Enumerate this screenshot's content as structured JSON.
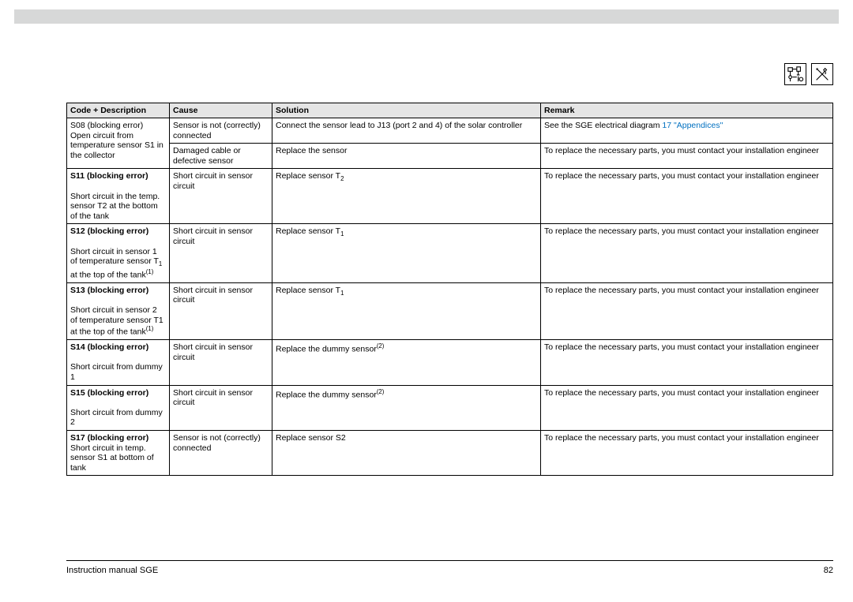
{
  "headers": {
    "code": "Code + Description",
    "cause": "Cause",
    "solution": "Solution",
    "remark": "Remark"
  },
  "rows": [
    {
      "code_html": "S08 (blocking error)<br>Open circuit from temperature sensor S1 in the collector",
      "code_rowspan": 2,
      "cause": "Sensor is not (correctly) connected",
      "solution": "Connect the sensor lead to J13 (port 2 and 4) of the solar controller",
      "remark_html": "See the SGE electrical diagram <span class=\"link\">17 \"Appendices\"</span>"
    },
    {
      "cause": "Damaged cable or defective sensor",
      "solution": "Replace the sensor",
      "remark": "To replace the necessary parts, you must contact your installation engineer"
    },
    {
      "code_html": "<span class=\"bold\">S11 (blocking error)</span><br><br>Short circuit in the temp. sensor T2 at the bottom of the tank",
      "cause": "Short circuit in sensor circuit",
      "solution_html": "Replace sensor T<span class=\"sub\">2</span>",
      "remark": "To replace the necessary parts, you must contact your installation engineer"
    },
    {
      "code_html": "<span class=\"bold\">S12 (blocking error)</span><br><br>Short circuit in sensor 1 of temperature sensor T<span class=\"sub\">1</span> at the top of the tank<span class=\"sup\">(1)</span>",
      "cause": "Short circuit in sensor circuit",
      "solution_html": "Replace sensor T<span class=\"sub\">1</span>",
      "remark": "To replace the necessary parts, you must contact your installation engineer"
    },
    {
      "code_html": "<span class=\"bold\">S13 (blocking error)</span><br><br>Short circuit in sensor 2 of temperature sensor T1 at the top of the tank<span class=\"sup\">(1)</span>",
      "cause": "Short circuit in sensor circuit",
      "solution_html": "Replace sensor T<span class=\"sub\">1</span>",
      "remark": "To replace the necessary parts, you must contact your installation engineer"
    },
    {
      "code_html": "<span class=\"bold\">S14 (blocking error)</span><br><br>Short circuit from dummy 1",
      "cause": "Short circuit in sensor circuit",
      "solution_html": "Replace the dummy sensor<span class=\"sup\">(2)</span>",
      "remark": "To replace the necessary parts, you must contact your installation engineer"
    },
    {
      "code_html": "<span class=\"bold\">S15 (blocking error)</span><br><br>Short circuit from dummy 2",
      "cause": "Short circuit in sensor circuit",
      "solution_html": "Replace the dummy sensor<span class=\"sup\">(2)</span>",
      "remark": "To replace the necessary parts, you must contact your installation engineer"
    },
    {
      "code_html": "<span class=\"bold\">S17 (blocking error)</span><br>Short circuit in temp. sensor S1 at bottom of tank",
      "cause": "Sensor is not (correctly) connected",
      "solution": "Replace sensor S2",
      "remark": "To replace the necessary parts, you must contact your installation engineer"
    }
  ],
  "footer": {
    "left": "Instruction manual SGE",
    "right": "82"
  }
}
